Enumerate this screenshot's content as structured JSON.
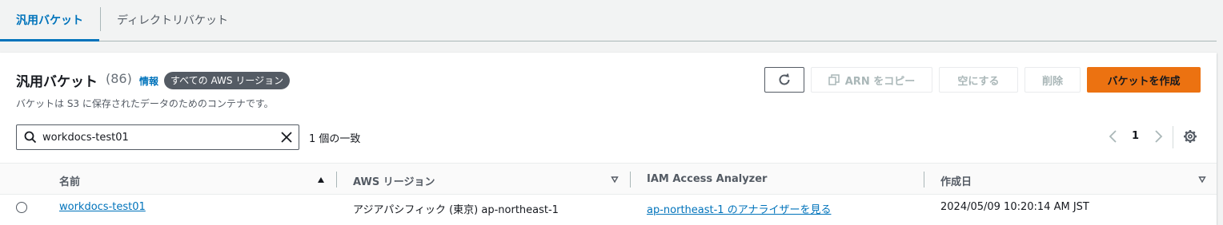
{
  "tabs": [
    {
      "label": "汎用バケット",
      "active": true
    },
    {
      "label": "ディレクトリバケット",
      "active": false
    }
  ],
  "header": {
    "title": "汎用バケット",
    "count": "(86)",
    "info": "情報",
    "region_badge": "すべての AWS リージョン",
    "description": "バケットは S3 に保存されたデータのためのコンテナです。"
  },
  "actions": {
    "refresh_icon": "refresh-icon",
    "copy_arn": "ARN をコピー",
    "empty": "空にする",
    "delete": "削除",
    "create": "バケットを作成"
  },
  "search": {
    "value": "workdocs-test01",
    "match_text": "1 個の一致"
  },
  "pagination": {
    "current_page": "1"
  },
  "table": {
    "columns": [
      "名前",
      "AWS リージョン",
      "IAM Access Analyzer",
      "作成日"
    ],
    "rows": [
      {
        "name": "workdocs-test01",
        "region": "アジアパシフィック (東京) ap-northeast-1",
        "analyzer": "ap-northeast-1 のアナライザーを見る",
        "created": "2024/05/09 10:20:14 AM JST"
      }
    ]
  },
  "colors": {
    "accent": "#0073bb",
    "primary_button": "#ec7211",
    "badge": "#545b64"
  }
}
